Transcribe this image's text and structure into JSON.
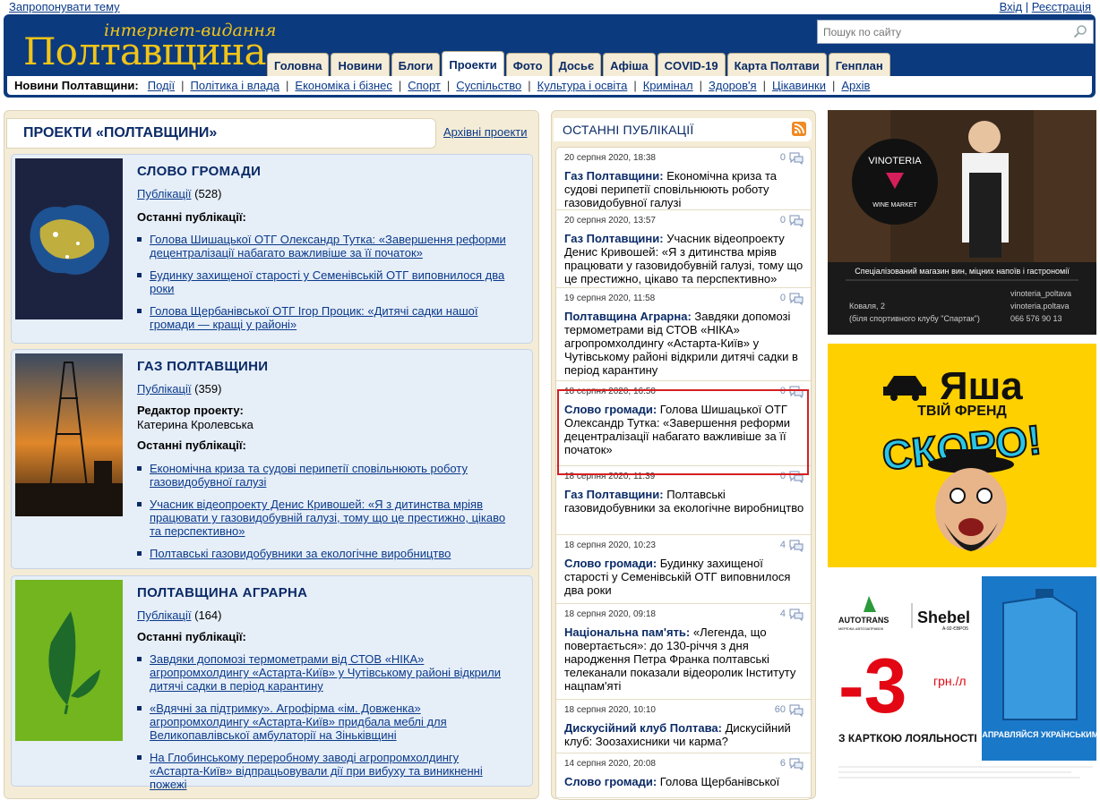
{
  "topbar": {
    "suggest": "Запропонувати тему",
    "login": "Вхід",
    "sep": "|",
    "register": "Реєстрація"
  },
  "logo": {
    "sub": "інтернет-видання",
    "main": "Полтавщина"
  },
  "search": {
    "placeholder": "Пошук по сайту"
  },
  "tabs": [
    {
      "label": "Головна"
    },
    {
      "label": "Новини"
    },
    {
      "label": "Блоги"
    },
    {
      "label": "Проекти",
      "active": true
    },
    {
      "label": "Фото"
    },
    {
      "label": "Досьє"
    },
    {
      "label": "Афіша"
    },
    {
      "label": "COVID-19"
    },
    {
      "label": "Карта Полтави"
    },
    {
      "label": "Генплан"
    }
  ],
  "subnav": {
    "label": "Новини Полтавщини:",
    "sep": "|",
    "items": [
      "Події",
      "Політика і влада",
      "Економіка і бізнес",
      "Спорт",
      "Суспільство",
      "Культура і освіта",
      "Кримінал",
      "Здоров'я",
      "Цікавинки",
      "Архів"
    ]
  },
  "left": {
    "title": "ПРОЕКТИ «ПОЛТАВЩИНИ»",
    "archive": "Архівні проекти",
    "projects": [
      {
        "title": "СЛОВО ГРОМАДИ",
        "pub_label": "Публікації",
        "pub_count": "(528)",
        "last_label": "Останні публікації:",
        "items": [
          "Голова Шишацької ОТГ Олександр Тутка: «Завершення реформи децентралізації набагато важливіше за її початок»",
          "Будинку захищеної старості у Семенівській ОТГ виповнилося два роки",
          "Голова Щербанівської ОТГ Ігор Процик: «Дитячі садки нашої громади — кращі у районі»"
        ]
      },
      {
        "title": "ГАЗ ПОЛТАВЩИНИ",
        "pub_label": "Публікації",
        "pub_count": "(359)",
        "editor_label": "Редактор проекту:",
        "editor": "Катерина Кролевська",
        "last_label": "Останні публікації:",
        "items": [
          "Економічна криза та судові перипетії сповільнюють роботу газовидобувної галузі",
          "Учасник відеопроекту Денис Кривошей: «Я з дитинства мріяв працювати у газовидобувній галузі, тому що це престижно, цікаво та перспективно»",
          "Полтавські газовидобувники за екологічне виробництво"
        ]
      },
      {
        "title": "ПОЛТАВЩИНА АГРАРНА",
        "pub_label": "Публікації",
        "pub_count": "(164)",
        "last_label": "Останні публікації:",
        "items": [
          "Завдяки допомозі термометрами від СТОВ «НІКА» агропромхолдингу «Астарта-Київ» у Чутівському районі відкрили дитячі садки в період карантину",
          "«Вдячні за підтримку». Агрофірма «ім. Довженка» агропромхолдингу «Астарта-Київ» придбала меблі для Великопавлівської амбулаторії на Зіньківщині",
          "На Глобинському переробному заводі агропромхолдингу «Астарта-Київ» відпрацьовували дії при вибуху та виникненні пожежі"
        ]
      }
    ]
  },
  "feed": {
    "title": "ОСТАННІ ПУБЛІКАЦІЇ",
    "items": [
      {
        "date": "20 серпня 2020, 18:38",
        "count": "0",
        "section": "Газ Полтавщини:",
        "text": " Економічна криза та судові перипетії сповільнюють роботу газовидобувної галузі"
      },
      {
        "date": "20 серпня 2020, 13:57",
        "count": "0",
        "section": "Газ Полтавщини:",
        "text": " Учасник відеопроекту Денис Кривошей: «Я з дитинства мріяв працювати у газовидобувній галузі, тому що це престижно, цікаво та перспективно»"
      },
      {
        "date": "19 серпня 2020, 11:58",
        "count": "0",
        "section": "Полтавщина Аграрна:",
        "text": " Завдяки допомозі термометрами від СТОВ «НІКА» агропромхолдингу «Астарта-Київ» у Чутівському районі відкрили дитячі садки в період карантину"
      },
      {
        "date": "18 серпня 2020, 16:50",
        "count": "0",
        "section": "Слово громади:",
        "text": " Голова Шишацької ОТГ Олександр Тутка: «Завершення реформи децентралізації набагато важливіше за її початок»"
      },
      {
        "date": "18 серпня 2020, 11:39",
        "count": "0",
        "section": "Газ Полтавщини:",
        "text": " Полтавські газовидобувники за екологічне виробництво"
      },
      {
        "date": "18 серпня 2020, 10:23",
        "count": "4",
        "section": "Слово громади:",
        "text": " Будинку захищеної старості у Семенівській ОТГ виповнилося два роки"
      },
      {
        "date": "18 серпня 2020, 09:18",
        "count": "4",
        "section": "Національна пам'ять:",
        "text": " «Легенда, що повертається»: до 130-річчя з дня народження Петра Франка полтавські телеканали показали відеоролик Інституту нацпам'яті"
      },
      {
        "date": "18 серпня 2020, 10:10",
        "count": "60",
        "section": "Дискусійний клуб Полтава:",
        "text": " Дискусійний клуб: Зоозахисники чи карма?"
      },
      {
        "date": "14 серпня 2020, 20:08",
        "count": "6",
        "section": "Слово громади:",
        "text": " Голова Щербанівської"
      }
    ]
  },
  "ads": {
    "vinoteria": {
      "brand": "VINOTERIA",
      "sub": "WINE MARKET",
      "desc": "Спеціалізований магазин вин, міцних напоїв і гастрономії",
      "addr1": "Коваля, 2",
      "addr2": "(біля спортивного клубу \"Спартак\")",
      "insta": "vinoteria_poltava",
      "fb": "vinoteria.poltava",
      "phone": "066 576 90 13"
    },
    "yasha": {
      "title": "Яша",
      "sub": "ТВІЙ ФРЕНД",
      "soon": "СКОРО!"
    },
    "shebel": {
      "brand1": "AUTOTRANS",
      "brand1_sub": "МЕРЕЖА АВТОЗАПРАВОК",
      "brand2": "Shebel",
      "brand2_sub": "А-92-ЄВРО5",
      "amount": "-3",
      "unit": "грн./л",
      "card": "З КАРТКОЮ ЛОЯЛЬНОСТІ",
      "canister": "ЗАПРАВЛЯЙСЯ УКРАЇНСЬКИМ!"
    },
    "colors": {
      "brand_blue": "#0c3a7e",
      "gold": "#f0c419",
      "yasha_bg": "#ffd000",
      "red": "#e30613"
    }
  }
}
